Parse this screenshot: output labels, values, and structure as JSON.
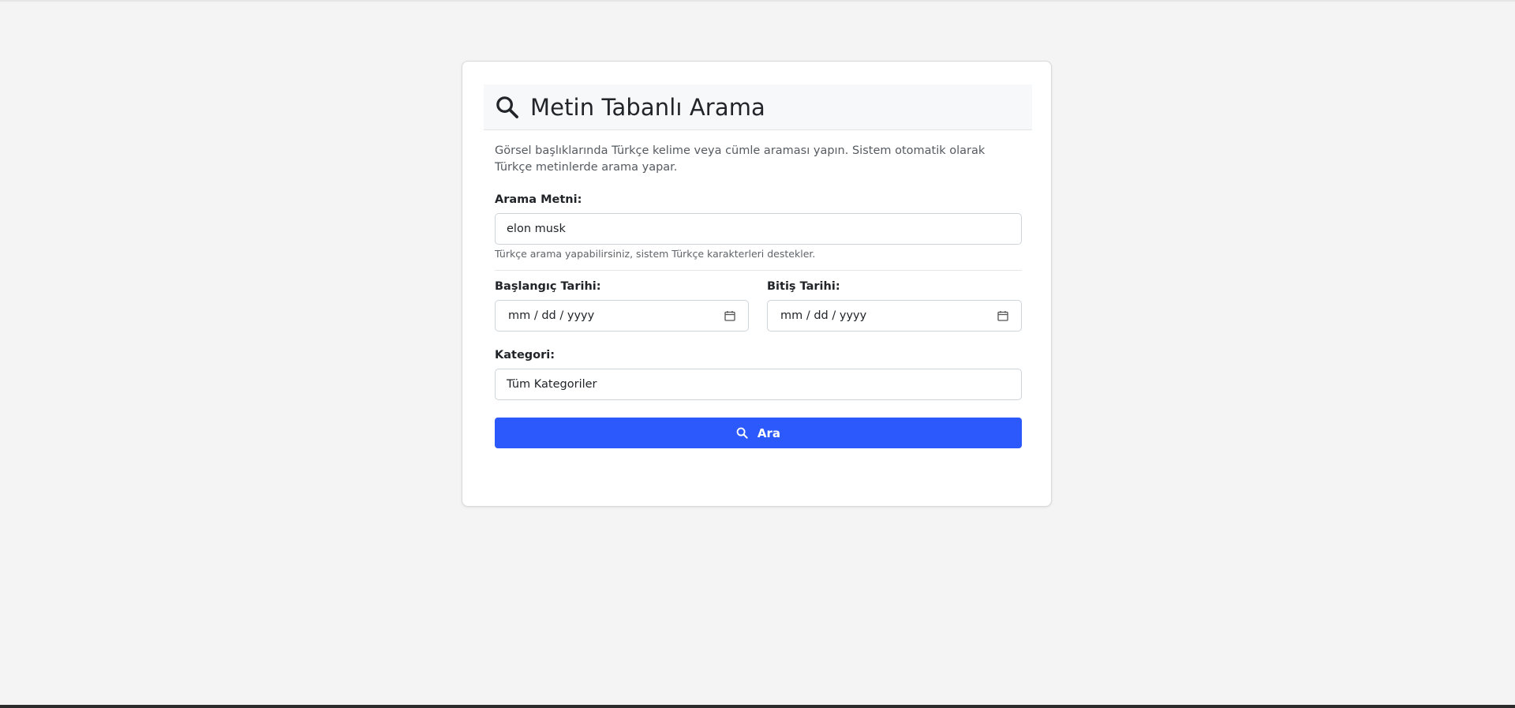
{
  "header": {
    "title": "Metin Tabanlı Arama",
    "icon": "search-icon"
  },
  "description": "Görsel başlıklarında Türkçe kelime veya cümle araması yapın. Sistem otomatik olarak Türkçe metinlerde arama yapar.",
  "search": {
    "label": "Arama Metni:",
    "value": "elon musk",
    "help": "Türkçe arama yapabilirsiniz, sistem Türkçe karakterleri destekler."
  },
  "start_date": {
    "label": "Başlangıç Tarihi:",
    "placeholder": "mm / dd / yyyy"
  },
  "end_date": {
    "label": "Bitiş Tarihi:",
    "placeholder": "mm / dd / yyyy"
  },
  "category": {
    "label": "Kategori:",
    "selected": "Tüm Kategoriler"
  },
  "submit": {
    "label": "Ara"
  },
  "colors": {
    "accent": "#2c59fc",
    "background": "#f4f4f4"
  }
}
